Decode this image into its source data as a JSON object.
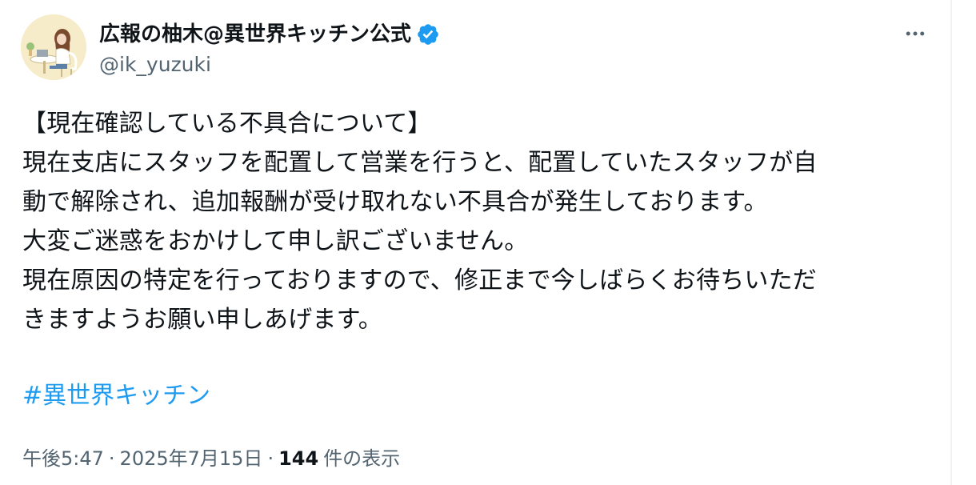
{
  "author": {
    "display_name": "広報の柚木@異世界キッチン公式",
    "handle": "@ik_yuzuki",
    "verified_icon": "verified-badge-icon",
    "avatar_icon": "avatar-illustration",
    "more_icon": "more-horizontal-icon"
  },
  "tweet": {
    "lines": [
      "【現在確認している不具合について】",
      "現在支店にスタッフを配置して営業を行うと、配置していたスタッフが自",
      "動で解除され、追加報酬が受け取れない不具合が発生しております。",
      "大変ご迷惑をおかけして申し訳ございません。",
      "現在原因の特定を行っておりますので、修正まで今しばらくお待ちいただ",
      "きますようお願い申しあげます。"
    ],
    "hashtag": "#異世界キッチン"
  },
  "meta": {
    "time": "午後5:47",
    "separator": "·",
    "date": "2025年7月15日",
    "views_count": "144",
    "views_label": "件の表示"
  },
  "colors": {
    "text": "#0f1419",
    "secondary": "#536471",
    "link": "#1d9bf0",
    "verified": "#1d9bf0",
    "avatar_bg": "#f6ecc9"
  }
}
